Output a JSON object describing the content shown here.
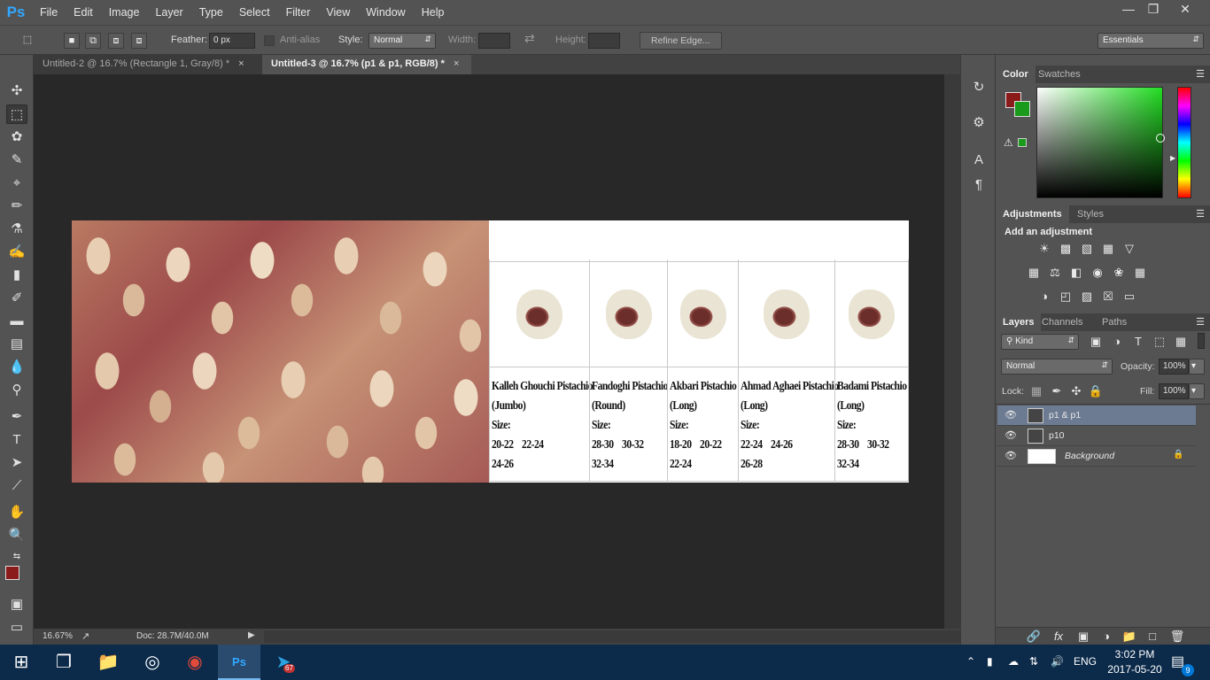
{
  "app": {
    "logo": "Ps",
    "menu": [
      "File",
      "Edit",
      "Image",
      "Layer",
      "Type",
      "Select",
      "Filter",
      "View",
      "Window",
      "Help"
    ],
    "window_controls": [
      "minimize-icon",
      "restore-icon",
      "close-icon"
    ]
  },
  "options_bar": {
    "feather_label": "Feather:",
    "feather_value": "0 px",
    "anti_alias_label": "Anti-alias",
    "style_label": "Style:",
    "style_value": "Normal",
    "width_label": "Width:",
    "height_label": "Height:",
    "refine_edge_label": "Refine Edge...",
    "workspace_value": "Essentials"
  },
  "tabs": [
    {
      "label": "Untitled-2 @ 16.7% (Rectangle 1, Gray/8) *",
      "active": false
    },
    {
      "label": "Untitled-3 @ 16.7% (p1 & p1, RGB/8) *",
      "active": true
    }
  ],
  "status": {
    "zoom": "16.67%",
    "doc_info": "Doc: 28.7M/40.0M"
  },
  "products": [
    {
      "name1": "Kalleh Ghouchi Pistachio",
      "name2": "(Jumbo)",
      "size_label": "Size:",
      "sizes1": "20-22    22-24",
      "sizes2": "24-26"
    },
    {
      "name1": "Fandoghi Pistachio",
      "name2": "(Round)",
      "size_label": "Size:",
      "sizes1": "28-30    30-32",
      "sizes2": "32-34"
    },
    {
      "name1": "Akbari Pistachio",
      "name2": "(Long)",
      "size_label": "Size:",
      "sizes1": "18-20    20-22",
      "sizes2": "22-24"
    },
    {
      "name1": "Ahmad Aghaei Pistachio",
      "name2": "(Long)",
      "size_label": "Size:",
      "sizes1": "22-24    24-26",
      "sizes2": "26-28"
    },
    {
      "name1": "Badami Pistachio",
      "name2": "(Long)",
      "size_label": "Size:",
      "sizes1": "28-30    30-32",
      "sizes2": "32-34"
    }
  ],
  "color_panel": {
    "tabs": [
      "Color",
      "Swatches"
    ],
    "foreground": "#8b1a1a",
    "background": "#1a9a1a"
  },
  "adjustments_panel": {
    "tabs": [
      "Adjustments",
      "Styles"
    ],
    "heading": "Add an adjustment"
  },
  "layers_panel": {
    "tabs": [
      "Layers",
      "Channels",
      "Paths"
    ],
    "filter_value": "Kind",
    "blend_mode": "Normal",
    "opacity_label": "Opacity:",
    "opacity_value": "100%",
    "lock_label": "Lock:",
    "fill_label": "Fill:",
    "fill_value": "100%",
    "layers": [
      {
        "name": "p1 & p1",
        "selected": true
      },
      {
        "name": "p10",
        "selected": false
      },
      {
        "name": "Background",
        "selected": false
      }
    ]
  },
  "taskbar": {
    "language": "ENG",
    "time": "3:02 PM",
    "date": "2017-05-20",
    "telegram_badge": "67",
    "notification_count": "9"
  }
}
